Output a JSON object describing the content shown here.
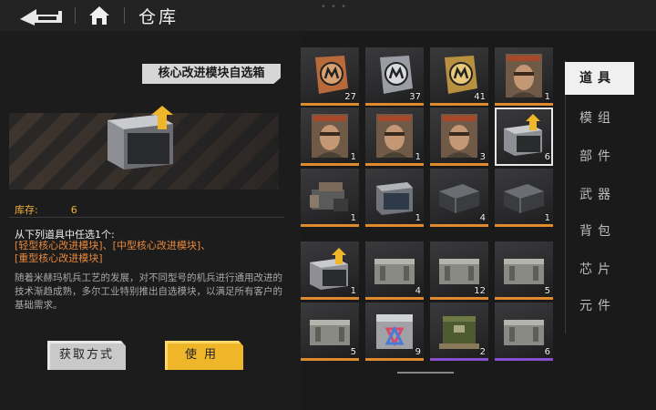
{
  "header": {
    "title": "仓库"
  },
  "detail": {
    "item_name": "核心改进模块自选箱",
    "stock_label": "库存:",
    "stock_value": "6",
    "choose_title": "从下列道具中任选1个:",
    "options": [
      "[轻型核心改进模块]",
      "[中型核心改进模块]",
      "[重型核心改进模块]"
    ],
    "description": "随着米赫玛机兵工艺的发展，对不同型号的机兵进行通用改进的技术渐趋成熟，多尔工业特别推出自选模块，以满足所有客户的基础需求。",
    "buttons": {
      "get": "获取方式",
      "use": "使用"
    }
  },
  "tabs": [
    {
      "label": "道具",
      "active": true
    },
    {
      "label": "模组",
      "active": false
    },
    {
      "label": "部件",
      "active": false
    },
    {
      "label": "武器",
      "active": false
    },
    {
      "label": "背包",
      "active": false
    },
    {
      "label": "芯片",
      "active": false
    },
    {
      "label": "元件",
      "active": false
    }
  ],
  "inventory": [
    {
      "icon": "m-badge-bronze-icon",
      "count": "27"
    },
    {
      "icon": "m-badge-silver-icon",
      "count": "37"
    },
    {
      "icon": "m-badge-gold-icon",
      "count": "41"
    },
    {
      "icon": "pilot-card-portrait-icon",
      "count": "1"
    },
    {
      "icon": "pilot-card-portrait-icon",
      "count": "1"
    },
    {
      "icon": "pilot-card-portrait-icon",
      "count": "1"
    },
    {
      "icon": "pilot-card-portrait-icon",
      "count": "3"
    },
    {
      "icon": "core-upgrade-box-icon",
      "count": "6",
      "selected": true
    },
    {
      "icon": "weapon-parts-crate-icon",
      "count": "1"
    },
    {
      "icon": "steel-case-icon",
      "count": "1"
    },
    {
      "icon": "dark-case-icon",
      "count": "4"
    },
    {
      "icon": "dark-case-icon",
      "count": "1"
    },
    {
      "icon": "core-upgrade-box-icon",
      "count": "1"
    },
    {
      "icon": "supply-crate-icon",
      "count": "4"
    },
    {
      "icon": "supply-crate-icon",
      "count": "12"
    },
    {
      "icon": "supply-crate-icon",
      "count": "5"
    },
    {
      "icon": "supply-crate-icon",
      "count": "5"
    },
    {
      "icon": "symbol-box-icon",
      "count": "9"
    },
    {
      "icon": "green-crate-icon",
      "count": "2",
      "rarity": "purple"
    },
    {
      "icon": "supply-crate-icon",
      "count": "6",
      "rarity": "purple"
    }
  ],
  "colors": {
    "accent": "#f0b62a",
    "orange_line": "#e08a2e",
    "purple_line": "#8a4fcf",
    "option_text": "#e8883a"
  }
}
